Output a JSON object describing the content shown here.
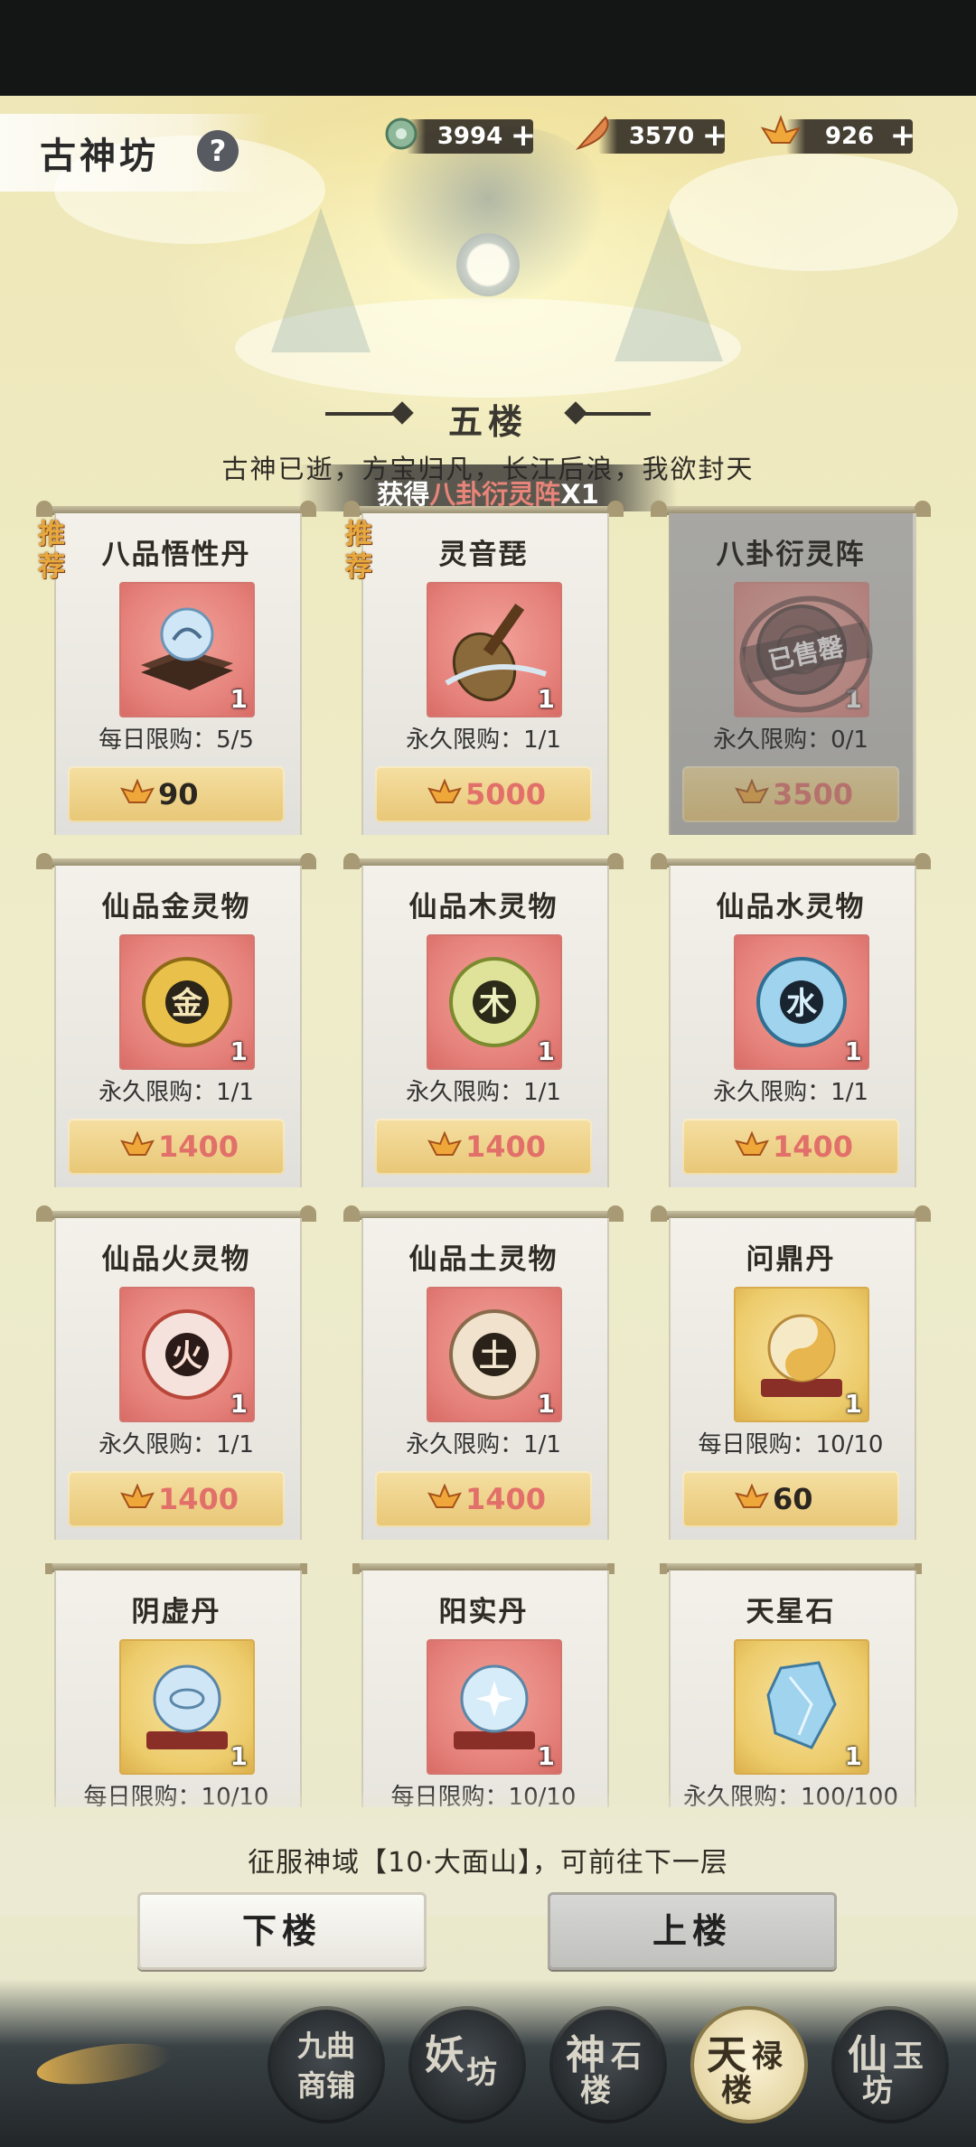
{
  "header": {
    "title": "古神坊",
    "help_label": "?",
    "currencies": [
      {
        "icon": "jade-icon",
        "value": "3994",
        "plus": "+"
      },
      {
        "icon": "feather-icon",
        "value": "3570",
        "plus": "+"
      },
      {
        "icon": "lotus-coin-icon",
        "value": "926",
        "plus": "+"
      }
    ]
  },
  "floor": {
    "title": "五楼",
    "subtitle": "古神已逝，方宝归凡，长江后浪，我欲封天",
    "toast_prefix": "获得",
    "toast_item": "八卦衍灵阵",
    "toast_suffix": "X1"
  },
  "items": [
    {
      "name": "八品悟性丹",
      "recommend": "推荐",
      "qty": "1",
      "limit": "每日限购：5/5",
      "price": "90"
    },
    {
      "name": "灵音琵",
      "recommend": "推荐",
      "qty": "1",
      "limit": "永久限购：1/1",
      "price": "5000"
    },
    {
      "name": "八卦衍灵阵",
      "qty": "1",
      "limit": "永久限购：0/1",
      "price": "3500",
      "stamp": "已售罄"
    },
    {
      "name": "仙品金灵物",
      "qty": "1",
      "limit": "永久限购：1/1",
      "price": "1400",
      "glyph": "金"
    },
    {
      "name": "仙品木灵物",
      "qty": "1",
      "limit": "永久限购：1/1",
      "price": "1400",
      "glyph": "木"
    },
    {
      "name": "仙品水灵物",
      "qty": "1",
      "limit": "永久限购：1/1",
      "price": "1400",
      "glyph": "水"
    },
    {
      "name": "仙品火灵物",
      "qty": "1",
      "limit": "永久限购：1/1",
      "price": "1400",
      "glyph": "火"
    },
    {
      "name": "仙品土灵物",
      "qty": "1",
      "limit": "永久限购：1/1",
      "price": "1400",
      "glyph": "土"
    },
    {
      "name": "问鼎丹",
      "qty": "1",
      "limit": "每日限购：10/10",
      "price": "60"
    },
    {
      "name": "阴虚丹",
      "qty": "1",
      "limit": "每日限购：10/10"
    },
    {
      "name": "阳实丹",
      "qty": "1",
      "limit": "每日限购：10/10"
    },
    {
      "name": "天星石",
      "qty": "1",
      "limit": "永久限购：100/100"
    }
  ],
  "footer": {
    "hint": "征服神域【10·大面山】，可前往下一层",
    "down_label": "下楼",
    "up_label": "上楼"
  },
  "nav": [
    {
      "line1": "九曲",
      "line2": "商铺"
    },
    {
      "main": "妖",
      "sub": "坊"
    },
    {
      "main": "神",
      "sub": "石",
      "extra": "楼"
    },
    {
      "main": "天",
      "sub": "禄",
      "extra": "楼",
      "active": true
    },
    {
      "main": "仙",
      "sub": "玉",
      "extra": "坊"
    }
  ],
  "colors": {
    "price_red": "#e2706a",
    "recommend": "#e7a93e",
    "toast_highlight": "#e9847a"
  }
}
